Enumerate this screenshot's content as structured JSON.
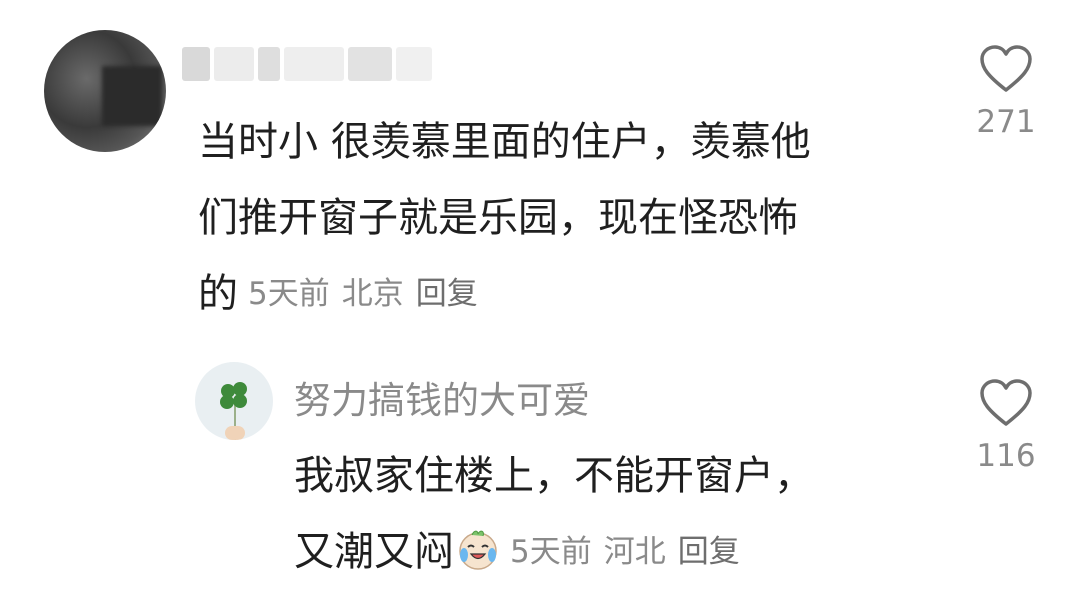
{
  "comment1": {
    "text_line1": "当时小 很羡慕里面的住户，羡慕他",
    "text_line2": "们推开窗子就是乐园，现在怪恐怖",
    "text_line3": "的",
    "time": "5天前",
    "location": "北京",
    "reply_label": "回复",
    "like_count": "271",
    "like_icon": "heart-outline-icon"
  },
  "comment2": {
    "username": "努力搞钱的大可爱",
    "text_line1": "我叔家住楼上，不能开窗户，",
    "text_line2": "又潮又闷",
    "emoji": "crying-laughing-emoji",
    "time": "5天前",
    "location": "河北",
    "reply_label": "回复",
    "like_count": "116",
    "like_icon": "heart-outline-icon"
  },
  "colors": {
    "text_primary": "#1f1f1f",
    "text_secondary": "#8a8a8a"
  }
}
